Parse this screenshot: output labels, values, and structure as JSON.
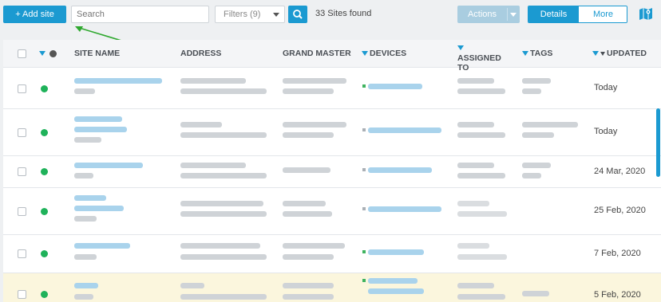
{
  "toolbar": {
    "add_site_label": "+ Add site",
    "search_placeholder": "Search",
    "filters_label": "Filters (9)",
    "sites_found": "33 Sites found",
    "actions_label": "Actions",
    "view_details": "Details",
    "view_more": "More"
  },
  "table": {
    "columns": {
      "site_name": "SITE NAME",
      "address": "ADDRESS",
      "grand_master": "GRAND MASTER",
      "devices": "DEVICES",
      "assigned_to": "ASSIGNED TO",
      "tags": "TAGS",
      "updated": "UPDATED"
    },
    "rows": [
      {
        "updated": "Today",
        "status": "online",
        "highlighted": false
      },
      {
        "updated": "Today",
        "status": "online",
        "highlighted": false
      },
      {
        "updated": "24 Mar, 2020",
        "status": "online",
        "highlighted": false
      },
      {
        "updated": "25 Feb, 2020",
        "status": "online",
        "highlighted": false
      },
      {
        "updated": "7 Feb, 2020",
        "status": "online",
        "highlighted": false
      },
      {
        "updated": "5 Feb, 2020",
        "status": "online",
        "highlighted": true
      }
    ]
  },
  "colors": {
    "accent": "#1b9ad1",
    "status_online": "#1fb25a",
    "annotation_arrow": "#2ea82e",
    "highlight_row": "#fbf6dd"
  },
  "icons": [
    "plus-icon",
    "search-icon",
    "chevron-down-icon",
    "map-icon",
    "filter-icon",
    "sort-desc-icon",
    "status-dot-icon"
  ]
}
